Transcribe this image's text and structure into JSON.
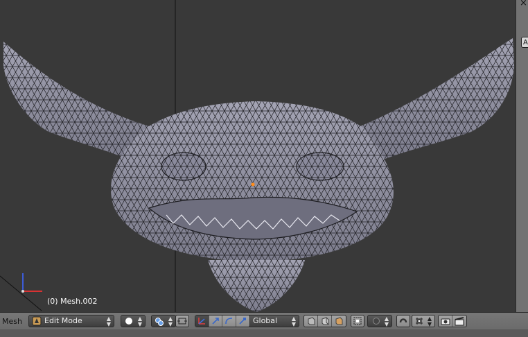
{
  "viewport": {
    "object_label": "(0) Mesh.002"
  },
  "right_panel": {
    "close_glyph": "×",
    "tab_label": "A"
  },
  "header": {
    "editor_label": "Mesh",
    "mode": {
      "label": "Edit Mode",
      "icon": "edit-mode-icon"
    },
    "shading_icon": "solid-sphere-icon",
    "pivot_icon": "pivot-point-icon",
    "orientation": {
      "label": "Global"
    },
    "select_modes": [
      "vertex-select-icon",
      "edge-select-icon",
      "face-select-icon"
    ],
    "proportional_icon": "proportional-edit-icon",
    "snap_icon": "snap-magnet-icon",
    "colors": {
      "accent": "#5680c2",
      "mesh": "#9a9aaa",
      "selected": "#ff8c1a"
    }
  }
}
